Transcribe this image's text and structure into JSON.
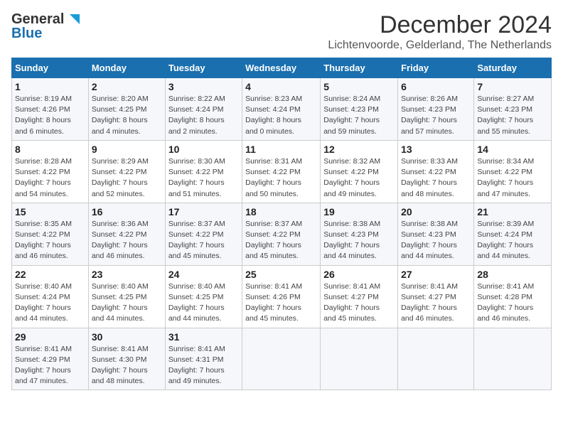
{
  "logo": {
    "line1": "General",
    "line2": "Blue"
  },
  "title": "December 2024",
  "subtitle": "Lichtenvoorde, Gelderland, The Netherlands",
  "days_header": [
    "Sunday",
    "Monday",
    "Tuesday",
    "Wednesday",
    "Thursday",
    "Friday",
    "Saturday"
  ],
  "weeks": [
    [
      {
        "day": "1",
        "lines": [
          "Sunrise: 8:19 AM",
          "Sunset: 4:26 PM",
          "Daylight: 8 hours",
          "and 6 minutes."
        ]
      },
      {
        "day": "2",
        "lines": [
          "Sunrise: 8:20 AM",
          "Sunset: 4:25 PM",
          "Daylight: 8 hours",
          "and 4 minutes."
        ]
      },
      {
        "day": "3",
        "lines": [
          "Sunrise: 8:22 AM",
          "Sunset: 4:24 PM",
          "Daylight: 8 hours",
          "and 2 minutes."
        ]
      },
      {
        "day": "4",
        "lines": [
          "Sunrise: 8:23 AM",
          "Sunset: 4:24 PM",
          "Daylight: 8 hours",
          "and 0 minutes."
        ]
      },
      {
        "day": "5",
        "lines": [
          "Sunrise: 8:24 AM",
          "Sunset: 4:23 PM",
          "Daylight: 7 hours",
          "and 59 minutes."
        ]
      },
      {
        "day": "6",
        "lines": [
          "Sunrise: 8:26 AM",
          "Sunset: 4:23 PM",
          "Daylight: 7 hours",
          "and 57 minutes."
        ]
      },
      {
        "day": "7",
        "lines": [
          "Sunrise: 8:27 AM",
          "Sunset: 4:23 PM",
          "Daylight: 7 hours",
          "and 55 minutes."
        ]
      }
    ],
    [
      {
        "day": "8",
        "lines": [
          "Sunrise: 8:28 AM",
          "Sunset: 4:22 PM",
          "Daylight: 7 hours",
          "and 54 minutes."
        ]
      },
      {
        "day": "9",
        "lines": [
          "Sunrise: 8:29 AM",
          "Sunset: 4:22 PM",
          "Daylight: 7 hours",
          "and 52 minutes."
        ]
      },
      {
        "day": "10",
        "lines": [
          "Sunrise: 8:30 AM",
          "Sunset: 4:22 PM",
          "Daylight: 7 hours",
          "and 51 minutes."
        ]
      },
      {
        "day": "11",
        "lines": [
          "Sunrise: 8:31 AM",
          "Sunset: 4:22 PM",
          "Daylight: 7 hours",
          "and 50 minutes."
        ]
      },
      {
        "day": "12",
        "lines": [
          "Sunrise: 8:32 AM",
          "Sunset: 4:22 PM",
          "Daylight: 7 hours",
          "and 49 minutes."
        ]
      },
      {
        "day": "13",
        "lines": [
          "Sunrise: 8:33 AM",
          "Sunset: 4:22 PM",
          "Daylight: 7 hours",
          "and 48 minutes."
        ]
      },
      {
        "day": "14",
        "lines": [
          "Sunrise: 8:34 AM",
          "Sunset: 4:22 PM",
          "Daylight: 7 hours",
          "and 47 minutes."
        ]
      }
    ],
    [
      {
        "day": "15",
        "lines": [
          "Sunrise: 8:35 AM",
          "Sunset: 4:22 PM",
          "Daylight: 7 hours",
          "and 46 minutes."
        ]
      },
      {
        "day": "16",
        "lines": [
          "Sunrise: 8:36 AM",
          "Sunset: 4:22 PM",
          "Daylight: 7 hours",
          "and 46 minutes."
        ]
      },
      {
        "day": "17",
        "lines": [
          "Sunrise: 8:37 AM",
          "Sunset: 4:22 PM",
          "Daylight: 7 hours",
          "and 45 minutes."
        ]
      },
      {
        "day": "18",
        "lines": [
          "Sunrise: 8:37 AM",
          "Sunset: 4:22 PM",
          "Daylight: 7 hours",
          "and 45 minutes."
        ]
      },
      {
        "day": "19",
        "lines": [
          "Sunrise: 8:38 AM",
          "Sunset: 4:23 PM",
          "Daylight: 7 hours",
          "and 44 minutes."
        ]
      },
      {
        "day": "20",
        "lines": [
          "Sunrise: 8:38 AM",
          "Sunset: 4:23 PM",
          "Daylight: 7 hours",
          "and 44 minutes."
        ]
      },
      {
        "day": "21",
        "lines": [
          "Sunrise: 8:39 AM",
          "Sunset: 4:24 PM",
          "Daylight: 7 hours",
          "and 44 minutes."
        ]
      }
    ],
    [
      {
        "day": "22",
        "lines": [
          "Sunrise: 8:40 AM",
          "Sunset: 4:24 PM",
          "Daylight: 7 hours",
          "and 44 minutes."
        ]
      },
      {
        "day": "23",
        "lines": [
          "Sunrise: 8:40 AM",
          "Sunset: 4:25 PM",
          "Daylight: 7 hours",
          "and 44 minutes."
        ]
      },
      {
        "day": "24",
        "lines": [
          "Sunrise: 8:40 AM",
          "Sunset: 4:25 PM",
          "Daylight: 7 hours",
          "and 44 minutes."
        ]
      },
      {
        "day": "25",
        "lines": [
          "Sunrise: 8:41 AM",
          "Sunset: 4:26 PM",
          "Daylight: 7 hours",
          "and 45 minutes."
        ]
      },
      {
        "day": "26",
        "lines": [
          "Sunrise: 8:41 AM",
          "Sunset: 4:27 PM",
          "Daylight: 7 hours",
          "and 45 minutes."
        ]
      },
      {
        "day": "27",
        "lines": [
          "Sunrise: 8:41 AM",
          "Sunset: 4:27 PM",
          "Daylight: 7 hours",
          "and 46 minutes."
        ]
      },
      {
        "day": "28",
        "lines": [
          "Sunrise: 8:41 AM",
          "Sunset: 4:28 PM",
          "Daylight: 7 hours",
          "and 46 minutes."
        ]
      }
    ],
    [
      {
        "day": "29",
        "lines": [
          "Sunrise: 8:41 AM",
          "Sunset: 4:29 PM",
          "Daylight: 7 hours",
          "and 47 minutes."
        ]
      },
      {
        "day": "30",
        "lines": [
          "Sunrise: 8:41 AM",
          "Sunset: 4:30 PM",
          "Daylight: 7 hours",
          "and 48 minutes."
        ]
      },
      {
        "day": "31",
        "lines": [
          "Sunrise: 8:41 AM",
          "Sunset: 4:31 PM",
          "Daylight: 7 hours",
          "and 49 minutes."
        ]
      },
      null,
      null,
      null,
      null
    ]
  ]
}
